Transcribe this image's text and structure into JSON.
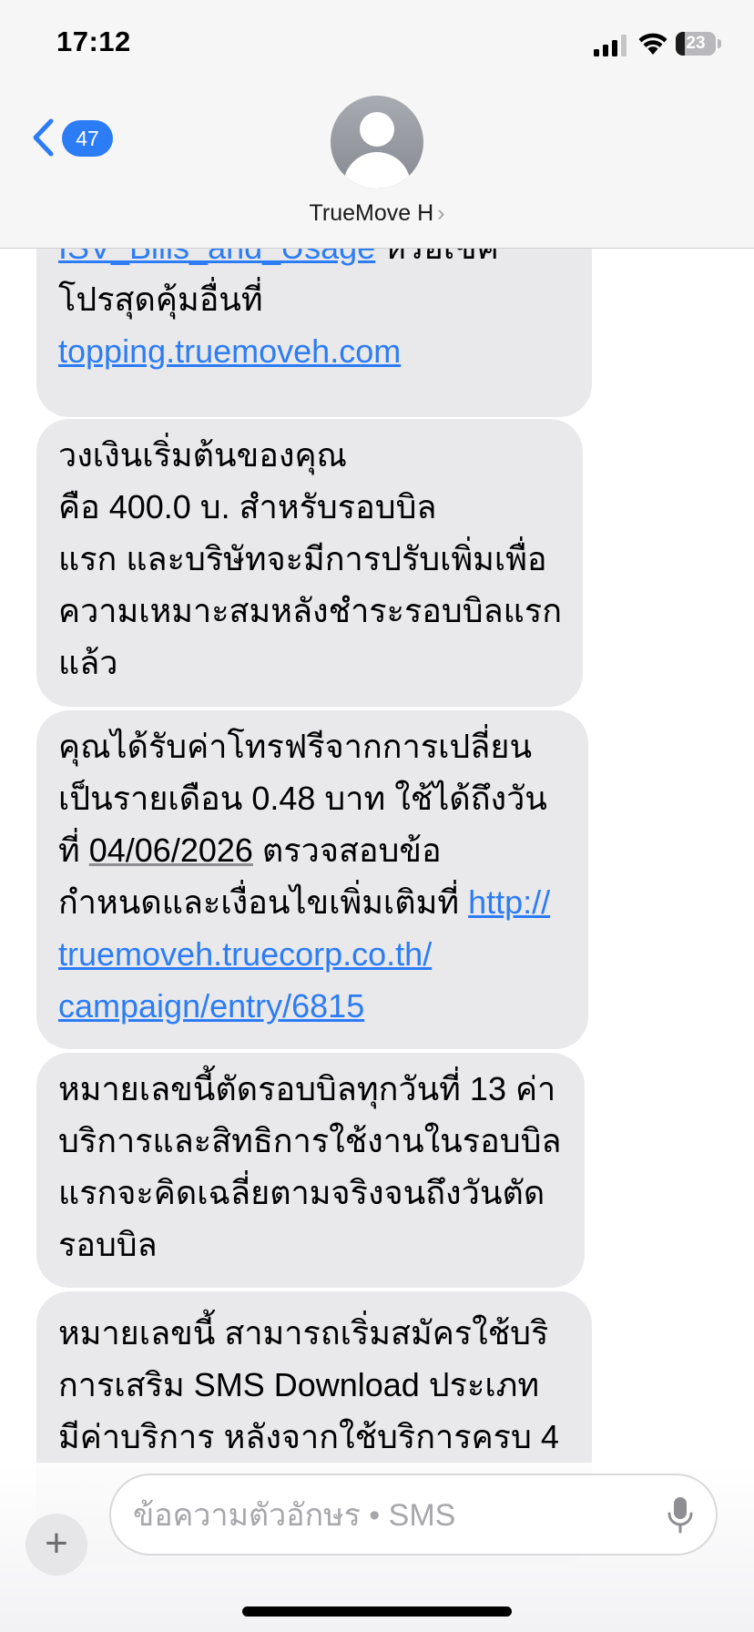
{
  "status_bar": {
    "time": "17:12",
    "battery_level": "23",
    "battery_fraction": 0.23
  },
  "header": {
    "unread_count": "47",
    "contact_name": "TrueMove H",
    "contact_chevron": "›"
  },
  "messages": [
    {
      "lines": [
        [
          {
            "text": "ISV_Bills_and_Usage",
            "style": "link"
          },
          {
            "text": " หรือเช็ค"
          }
        ],
        [
          {
            "text": "โปรสุดคุ้มอื่นที่"
          }
        ],
        [
          {
            "text": "topping.truemoveh.com",
            "style": "link"
          }
        ]
      ]
    },
    {
      "lines": [
        [
          {
            "text": "วงเงินเริ่มต้นของคุณ"
          }
        ],
        [
          {
            "text": "คือ 400.0 บ. สำหรับรอบบิล"
          }
        ],
        [
          {
            "text": "แรก และบริษัทจะมีการปรับเพิ่มเพื่อ"
          }
        ],
        [
          {
            "text": "ความเหมาะสมหลังชำระรอบบิลแรก"
          }
        ],
        [
          {
            "text": "แล้ว"
          }
        ]
      ]
    },
    {
      "lines": [
        [
          {
            "text": "คุณได้รับค่าโทรฟรีจากการเปลี่ยน"
          }
        ],
        [
          {
            "text": "เป็นรายเดือน 0.48 บาท ใช้ได้ถึงวัน"
          }
        ],
        [
          {
            "text": "ที่ "
          },
          {
            "text": "04/06/2026",
            "style": "date"
          },
          {
            "text": " ตรวจสอบข้อ"
          }
        ],
        [
          {
            "text": "กำหนดและเงื่อนไขเพิ่มเติมที่ "
          },
          {
            "text": "http://",
            "style": "link"
          }
        ],
        [
          {
            "text": "truemoveh.truecorp.co.th/",
            "style": "link"
          }
        ],
        [
          {
            "text": "campaign/entry/6815",
            "style": "link"
          }
        ]
      ]
    },
    {
      "lines": [
        [
          {
            "text": "หมายเลขนี้ตัดรอบบิลทุกวันที่ 13 ค่า"
          }
        ],
        [
          {
            "text": "บริการและสิทธิการใช้งานในรอบบิล"
          }
        ],
        [
          {
            "text": "แรกจะคิดเฉลี่ยตามจริงจนถึงวันตัด"
          }
        ],
        [
          {
            "text": "รอบบิล"
          }
        ]
      ]
    },
    {
      "lines": [
        [
          {
            "text": "หมายเลขนี้ สามารถเริ่มสมัครใช้บริ"
          }
        ],
        [
          {
            "text": "การเสริม SMS Download ประเภท"
          }
        ],
        [
          {
            "text": "มีค่าบริการ หลังจากใช้บริการครบ 4"
          }
        ]
      ]
    }
  ],
  "composer": {
    "plus_label": "+",
    "placeholder": "ข้อความตัวอักษร • SMS"
  },
  "icons": {
    "signal": "signal-icon",
    "wifi": "wifi-icon",
    "battery": "battery-icon",
    "back": "chevron-left-icon",
    "avatar": "person-icon",
    "mic": "microphone-icon"
  },
  "colors": {
    "accent": "#2C7CF6",
    "bubble": "#E9E9EB",
    "header_bg": "#F6F6F6"
  }
}
